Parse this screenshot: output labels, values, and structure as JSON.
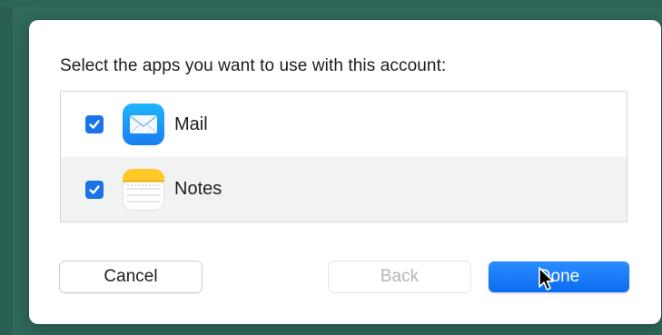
{
  "dialog": {
    "prompt": "Select the apps you want to use with this account:",
    "apps": [
      {
        "label": "Mail",
        "checked": true,
        "icon": "mail-icon"
      },
      {
        "label": "Notes",
        "checked": true,
        "icon": "notes-icon"
      }
    ],
    "buttons": {
      "cancel": "Cancel",
      "back": "Back",
      "done": "Done"
    }
  },
  "colors": {
    "accent": "#1a73e8",
    "desktop": "#2f6a5c",
    "disabled_text": "#b4b4b4"
  }
}
